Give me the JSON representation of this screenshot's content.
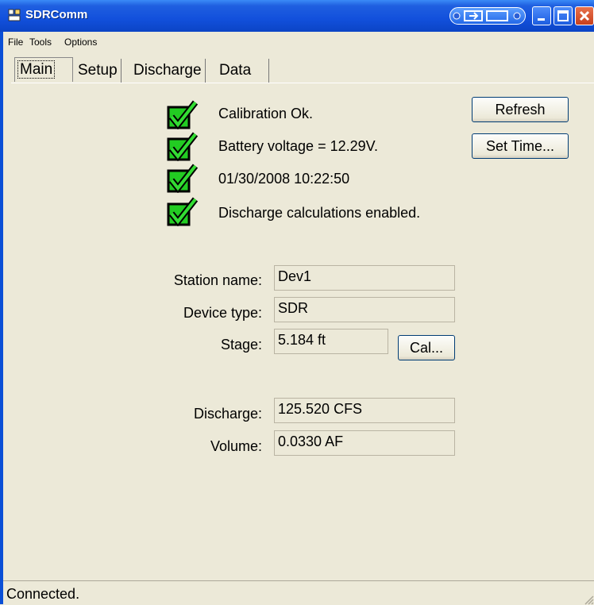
{
  "window": {
    "title": "SDRComm"
  },
  "menu": {
    "items": [
      "File",
      "Tools",
      "Options"
    ]
  },
  "tabs": [
    "Main",
    "Setup",
    "Discharge",
    "Data"
  ],
  "status_items": [
    {
      "text": "Calibration Ok.",
      "state": "ok"
    },
    {
      "text": "Battery voltage = 12.29V.",
      "state": "ok"
    },
    {
      "text": "01/30/2008 10:22:50",
      "state": "ok"
    },
    {
      "text": "Discharge calculations enabled.",
      "state": "ok"
    }
  ],
  "buttons": {
    "refresh": "Refresh",
    "set_time": "Set Time...",
    "cal": "Cal..."
  },
  "fields": {
    "station_name": {
      "label": "Station name:",
      "value": "Dev1"
    },
    "device_type": {
      "label": "Device type:",
      "value": "SDR"
    },
    "stage": {
      "label": "Stage:",
      "value": "5.184 ft"
    },
    "discharge": {
      "label": "Discharge:",
      "value": "125.520 CFS"
    },
    "volume": {
      "label": "Volume:",
      "value": "0.0330 AF"
    }
  },
  "statusbar": {
    "text": "Connected."
  },
  "colors": {
    "titlebar": "#1250dc",
    "check": "#22cc22",
    "panel": "#ece9d8"
  }
}
